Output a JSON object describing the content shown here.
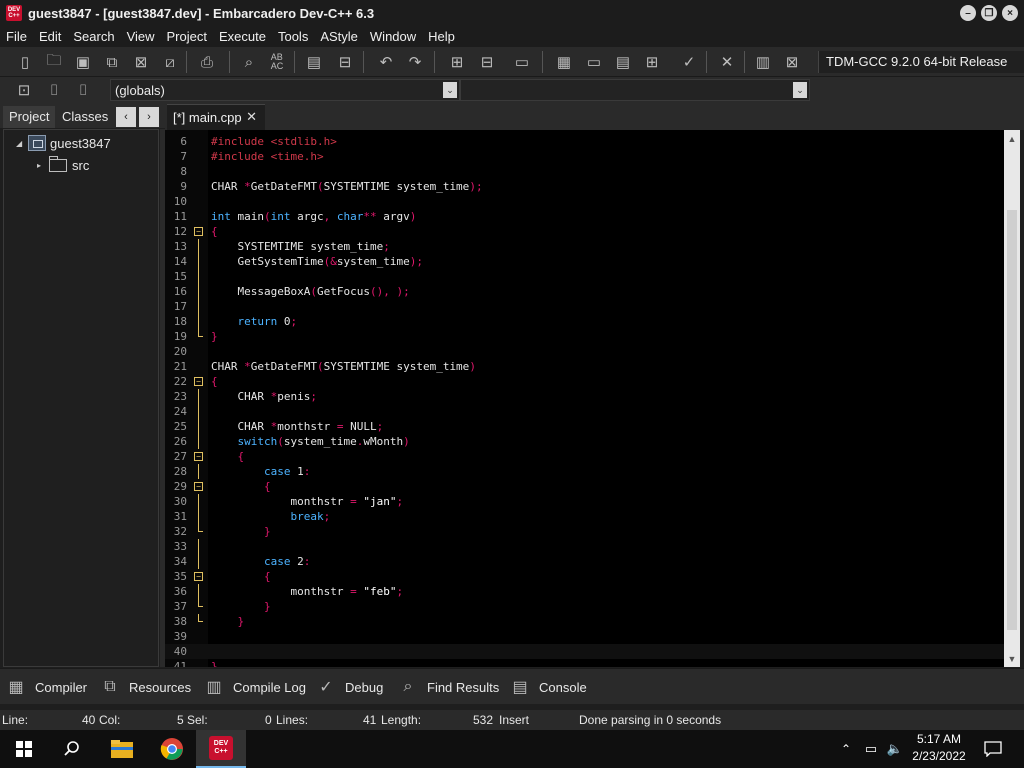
{
  "window": {
    "title": "guest3847 - [guest3847.dev] - Embarcadero Dev-C++ 6.3",
    "app_icon_text": "DEV C++"
  },
  "menu": [
    "File",
    "Edit",
    "Search",
    "View",
    "Project",
    "Execute",
    "Tools",
    "AStyle",
    "Window",
    "Help"
  ],
  "toolbar": {
    "compiler": "TDM-GCC 9.2.0 64-bit Release",
    "scope_combo": "(globals)",
    "member_combo": ""
  },
  "left_panel": {
    "tabs": [
      "Project",
      "Classes"
    ],
    "tree": {
      "project": "guest3847",
      "folder": "src"
    }
  },
  "editor": {
    "tab_label": "[*] main.cpp",
    "lines": [
      {
        "n": "6",
        "text": "#include <stdlib.h>"
      },
      {
        "n": "7",
        "text": "#include <time.h>"
      },
      {
        "n": "8",
        "text": ""
      },
      {
        "n": "9",
        "text": "CHAR *GetDateFMT(SYSTEMTIME system_time);"
      },
      {
        "n": "10",
        "text": ""
      },
      {
        "n": "11",
        "text": "int main(int argc, char** argv)"
      },
      {
        "n": "12",
        "text": "{"
      },
      {
        "n": "13",
        "text": "    SYSTEMTIME system_time;"
      },
      {
        "n": "14",
        "text": "    GetSystemTime(&system_time);"
      },
      {
        "n": "15",
        "text": ""
      },
      {
        "n": "16",
        "text": "    MessageBoxA(GetFocus(), );"
      },
      {
        "n": "17",
        "text": ""
      },
      {
        "n": "18",
        "text": "    return 0;"
      },
      {
        "n": "19",
        "text": "}"
      },
      {
        "n": "20",
        "text": ""
      },
      {
        "n": "21",
        "text": "CHAR *GetDateFMT(SYSTEMTIME system_time)"
      },
      {
        "n": "22",
        "text": "{"
      },
      {
        "n": "23",
        "text": "    CHAR *penis;"
      },
      {
        "n": "24",
        "text": ""
      },
      {
        "n": "25",
        "text": "    CHAR *monthstr = NULL;"
      },
      {
        "n": "26",
        "text": "    switch(system_time.wMonth)"
      },
      {
        "n": "27",
        "text": "    {"
      },
      {
        "n": "28",
        "text": "        case 1:"
      },
      {
        "n": "29",
        "text": "        {"
      },
      {
        "n": "30",
        "text": "            monthstr = \"jan\";"
      },
      {
        "n": "31",
        "text": "            break;"
      },
      {
        "n": "32",
        "text": "        }"
      },
      {
        "n": "33",
        "text": ""
      },
      {
        "n": "34",
        "text": "        case 2:"
      },
      {
        "n": "35",
        "text": "        {"
      },
      {
        "n": "36",
        "text": "            monthstr = \"feb\";"
      },
      {
        "n": "37",
        "text": "        }"
      },
      {
        "n": "38",
        "text": "    }"
      },
      {
        "n": "39",
        "text": ""
      },
      {
        "n": "40",
        "text": ""
      },
      {
        "n": "41",
        "text": "}"
      }
    ]
  },
  "bottom_tabs": [
    "Compiler",
    "Resources",
    "Compile Log",
    "Debug",
    "Find Results",
    "Console"
  ],
  "status": {
    "line_label": "Line:",
    "line_value": "40",
    "col_label": "Col:",
    "col_value": "5",
    "sel_label": "Sel:",
    "sel_value": "0",
    "lines_label": "Lines:",
    "lines_value": "41",
    "length_label": "Length:",
    "length_value": "532",
    "mode": "Insert",
    "message": "Done parsing in 0 seconds"
  },
  "taskbar": {
    "time": "5:17 AM",
    "date": "2/23/2022",
    "devcpp_icon_text": "DEV C++"
  },
  "colors": {
    "preprocessor": "#d0384a",
    "keyword": "#4db3ff",
    "operator": "#e0186c",
    "fold_marker": "#e0c060",
    "taskbar_active": "#c8102e"
  }
}
